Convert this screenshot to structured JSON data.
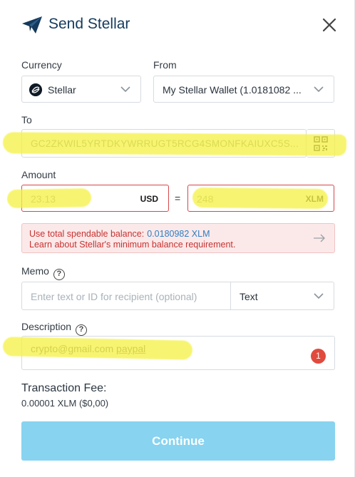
{
  "header": {
    "title": "Send Stellar"
  },
  "form": {
    "currency_label": "Currency",
    "currency_value": "Stellar",
    "from_label": "From",
    "from_value": "My Stellar Wallet (1.0181082 ...",
    "to_label": "To",
    "to_value": "GC2ZKWIL5YRTDKYWRRUGT5RCG4SMONFKAIUXC5S...",
    "amount_label": "Amount",
    "amount_usd_value": "23.13",
    "amount_usd_unit": "USD",
    "equals": "=",
    "amount_xlm_value": "248",
    "amount_xlm_unit": "XLM",
    "alert_line1": "Use total spendable balance:",
    "alert_balance": "0.0180982 XLM",
    "alert_line2": "Learn about Stellar's minimum balance requirement.",
    "memo_label": "Memo",
    "memo_placeholder": "Enter text or ID for recipient (optional)",
    "memo_type": "Text",
    "description_label": "Description",
    "description_value_part1": "crypto@gmail.com ",
    "description_value_part2": "paypal",
    "description_badge": "1",
    "fee_title": "Transaction Fee:",
    "fee_value": "0.00001 XLM  ($0,00)",
    "continue_label": "Continue"
  },
  "colors": {
    "accent": "#143a5c",
    "error": "#d7474b",
    "link": "#2c7fc4",
    "button": "#87d3f0",
    "highlight": "#f6f24a"
  },
  "icons": [
    "send-paper-plane-icon",
    "close-icon",
    "stellar-coin-icon",
    "chevron-down-icon",
    "qr-code-icon",
    "arrow-right-icon",
    "help-icon"
  ]
}
